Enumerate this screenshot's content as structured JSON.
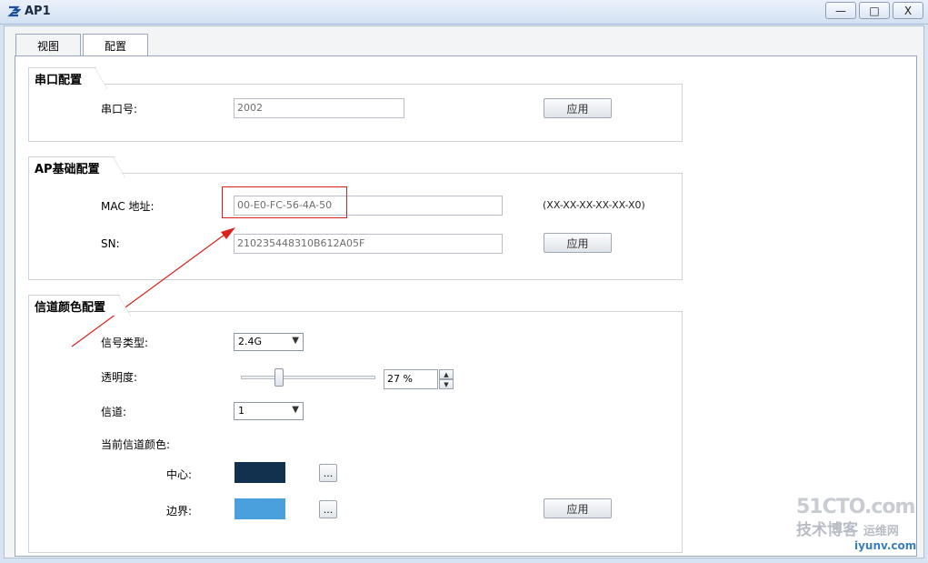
{
  "window": {
    "title": "AP1",
    "minimize_glyph": "—",
    "maximize_glyph": "□",
    "close_glyph": "X"
  },
  "tabs": [
    {
      "label": "视图",
      "active": false
    },
    {
      "label": "配置",
      "active": true
    }
  ],
  "serial_config": {
    "legend": "串口配置",
    "port_label": "串口号:",
    "port_value": "2002",
    "apply_label": "应用"
  },
  "ap_basic_config": {
    "legend": "AP基础配置",
    "mac_label": "MAC 地址:",
    "mac_value": "00-E0-FC-56-4A-50",
    "mac_format_hint": "(XX-XX-XX-XX-XX-X0)",
    "sn_label": "SN:",
    "sn_value": "210235448310B612A05F",
    "apply_label": "应用"
  },
  "channel_color_config": {
    "legend": "信道颜色配置",
    "signal_type_label": "信号类型:",
    "signal_type_value": "2.4G",
    "transparency_label": "透明度:",
    "transparency_value": "27 %",
    "transparency_percent": 27,
    "channel_label": "信道:",
    "channel_value": "1",
    "current_color_label": "当前信道颜色:",
    "center_label": "中心:",
    "center_color": "#12314f",
    "border_label": "边界:",
    "border_color": "#4aa0dc",
    "more_glyph": "...",
    "apply_label": "应用"
  },
  "annotation": {
    "highlight_color": "#d9211c"
  },
  "watermark": {
    "brand": "51CTO.com",
    "line2": "技术博客",
    "line3": "运维网",
    "line4": "iyunv.com"
  }
}
